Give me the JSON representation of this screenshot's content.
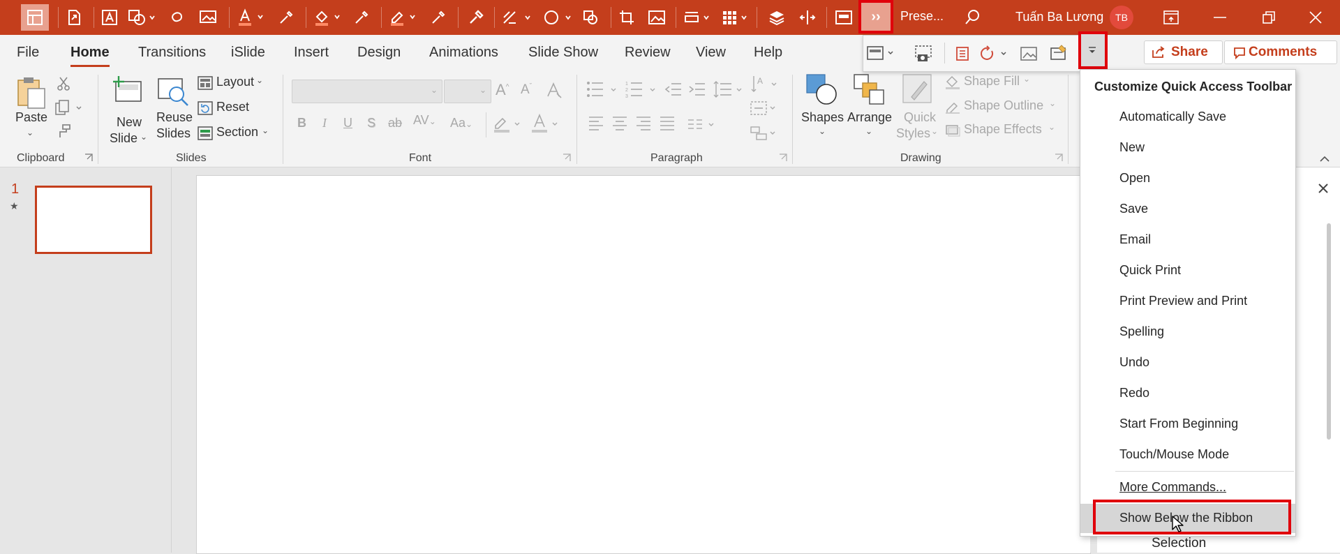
{
  "window": {
    "title": "Prese...",
    "user_name": "Tuấn Ba Lương",
    "user_initials": "TB",
    "overflow_button_label": "››"
  },
  "tabs": [
    "File",
    "Home",
    "Transitions",
    "iSlide",
    "Insert",
    "Design",
    "Animations",
    "Slide Show",
    "Review",
    "View",
    "Help"
  ],
  "share": {
    "share_label": "Share",
    "comments_label": "Comments"
  },
  "ribbon": {
    "clipboard": {
      "group": "Clipboard",
      "paste": "Paste"
    },
    "slides": {
      "group": "Slides",
      "new_slide_1": "New",
      "new_slide_2": "Slide",
      "reuse_1": "Reuse",
      "reuse_2": "Slides",
      "layout": "Layout",
      "reset": "Reset",
      "section": "Section"
    },
    "font": {
      "group": "Font"
    },
    "paragraph": {
      "group": "Paragraph"
    },
    "drawing": {
      "group": "Drawing",
      "shapes": "Shapes",
      "arrange": "Arrange",
      "quick_1": "Quick",
      "quick_2": "Styles",
      "shape_fill": "Shape Fill",
      "shape_outline": "Shape Outline",
      "shape_effects": "Shape Effects"
    }
  },
  "thumbnails": [
    {
      "number": "1"
    }
  ],
  "right_pane": {
    "partial_label": "Selection"
  },
  "menu": {
    "title": "Customize Quick Access Toolbar",
    "items": [
      "Automatically Save",
      "New",
      "Open",
      "Save",
      "Email",
      "Quick Print",
      "Print Preview and Print",
      "Spelling",
      "Undo",
      "Redo",
      "Start From Beginning",
      "Touch/Mouse Mode"
    ],
    "more_commands": "More Commands...",
    "show_below": "Show Below the Ribbon"
  },
  "colors": {
    "accent": "#c43e1c",
    "highlight": "#e0000b"
  }
}
